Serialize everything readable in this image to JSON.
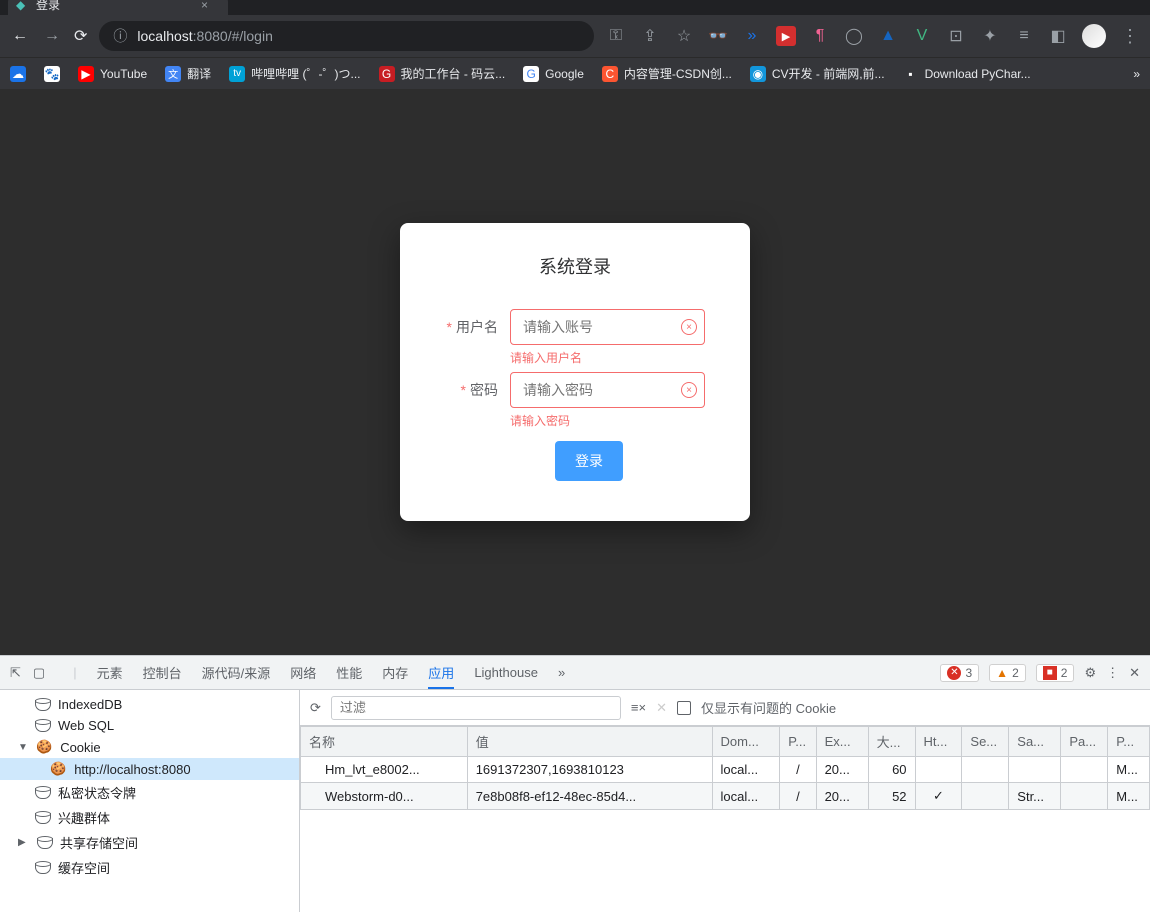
{
  "tab": {
    "title": "登录"
  },
  "url": {
    "host": "localhost",
    "port": ":8080",
    "path": "/#/login"
  },
  "bookmarks": [
    {
      "label": "",
      "color": "#1a73e8"
    },
    {
      "label": "",
      "color": "#1a73e8"
    },
    {
      "label": "YouTube",
      "color": "#ff0000"
    },
    {
      "label": "翻译",
      "color": "#4285f4"
    },
    {
      "label": "哔哩哔哩 (゜-゜)つ...",
      "color": "#00a1d6"
    },
    {
      "label": "我的工作台 - 码云...",
      "color": "#c71d23"
    },
    {
      "label": "Google",
      "color": "#fff"
    },
    {
      "label": "内容管理-CSDN创...",
      "color": "#fc5531"
    },
    {
      "label": "CV开发 - 前端网,前...",
      "color": "#1296db"
    },
    {
      "label": "Download PyChar...",
      "color": "#000"
    }
  ],
  "login": {
    "title": "系统登录",
    "username_label": "用户名",
    "username_placeholder": "请输入账号",
    "username_error": "请输入用户名",
    "password_label": "密码",
    "password_placeholder": "请输入密码",
    "password_error": "请输入密码",
    "submit": "登录"
  },
  "devtools": {
    "tabs": [
      "元素",
      "控制台",
      "源代码/来源",
      "网络",
      "性能",
      "内存",
      "应用",
      "Lighthouse"
    ],
    "active_tab": "应用",
    "errors": "3",
    "warnings": "2",
    "issues": "2",
    "side": {
      "indexeddb": "IndexedDB",
      "websql": "Web SQL",
      "cookie": "Cookie",
      "cookie_host": "http://localhost:8080",
      "private": "私密状态令牌",
      "interest": "兴趣群体",
      "shared": "共享存储空间",
      "cache": "缓存空间"
    },
    "toolbar": {
      "filter_placeholder": "过滤",
      "only_issues": "仅显示有问题的 Cookie"
    },
    "table": {
      "headers": [
        "名称",
        "值",
        "Dom...",
        "P...",
        "Ex...",
        "大...",
        "Ht...",
        "Se...",
        "Sa...",
        "Pa...",
        "P..."
      ],
      "rows": [
        {
          "name": "Hm_lvt_e8002...",
          "value": "1691372307,1693810123",
          "domain": "local...",
          "path": "/",
          "expires": "20...",
          "size": "60",
          "http": "",
          "secure": "",
          "same": "",
          "part": "",
          "prio": "M..."
        },
        {
          "name": "Webstorm-d0...",
          "value": "7e8b08f8-ef12-48ec-85d4...",
          "domain": "local...",
          "path": "/",
          "expires": "20...",
          "size": "52",
          "http": "✓",
          "secure": "",
          "same": "Str...",
          "part": "",
          "prio": "M..."
        }
      ]
    }
  }
}
